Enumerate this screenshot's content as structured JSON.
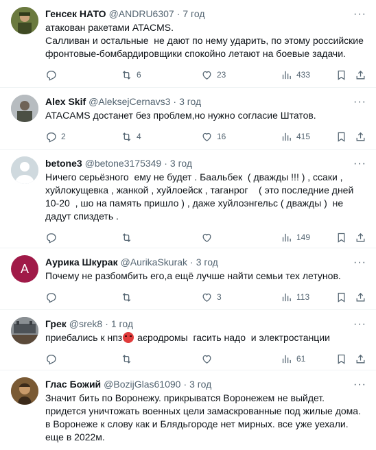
{
  "tweets": [
    {
      "name": "Генсек НАТО",
      "handle": "@ANDRU6307",
      "time": "7 год",
      "text": "атакован ракетами ATACMS.\nСалливан и остальные  не дают по нему ударить, по этому российские фронтовые-бомбардировщики спокойно летают на боевые задачи.",
      "replies": "",
      "retweets": "6",
      "likes": "23",
      "views": "433"
    },
    {
      "name": "Alex Skif",
      "handle": "@AleksejCernavs3",
      "time": "3 год",
      "text": "ATACAMS достанет без проблем,но нужно согласие Штатов.",
      "replies": "2",
      "retweets": "4",
      "likes": "16",
      "views": "415"
    },
    {
      "name": "betone3",
      "handle": "@betone3175349",
      "time": "3 год",
      "text": "Ничего серьёзного  ему не будет . Баальбек  ( дважды !!! ) , ссаки , хуйлокущевка , жанкой , хуйлоейск , таганрог    ( это последние дней 10-20  , шо на память пришло ) , даже хуйлоэнгельс ( дважды )  не дадут спиздеть .",
      "replies": "",
      "retweets": "",
      "likes": "",
      "views": "149"
    },
    {
      "name": "Аурика Шкурак",
      "handle": "@AurikaSkurak",
      "time": "3 год",
      "avatar_letter": "A",
      "text": "Почему не разбомбить его,а ещё лучше найти семьи тех летунов.",
      "replies": "",
      "retweets": "",
      "likes": "3",
      "views": "113"
    },
    {
      "name": "Грек",
      "handle": "@srek8",
      "time": "1 год",
      "text_before": "приебались к нпз",
      "text_after": " аєродромы  гасить надо  и электростанции",
      "replies": "",
      "retweets": "",
      "likes": "",
      "views": "61"
    },
    {
      "name": "Глас Божий",
      "handle": "@BozijGlas61090",
      "time": "3 год",
      "text": "Значит бить по Воронежу. прикрыватся Воронежем не выйдет. придется уничтожать военных цели замаскрованные под жилые дома. в Воронеже к слову как и Блядьгороде нет мирных. все уже уехали. еще в 2022м."
    }
  ],
  "separator": "·",
  "more": "···",
  "colors": {
    "text": "#0f1419",
    "muted": "#536471",
    "divider": "#eff3f4",
    "aurika_avatar": "#a01a48"
  }
}
